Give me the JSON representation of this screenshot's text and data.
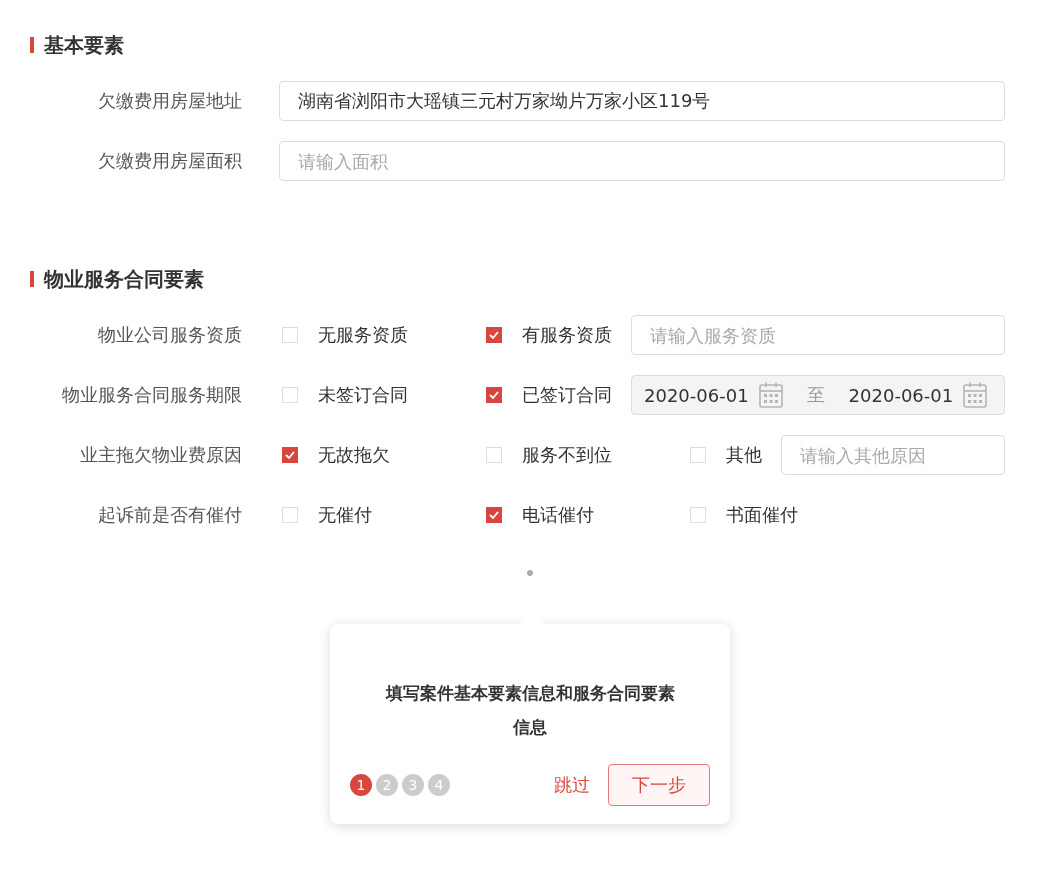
{
  "sections": [
    {
      "title": "基本要素",
      "rows": [
        {
          "label": "欠缴费用房屋地址",
          "items": [
            {
              "kind": "input",
              "value": "湖南省浏阳市大瑶镇三元村万家坳片万家小区119号"
            }
          ]
        },
        {
          "label": "欠缴费用房屋面积",
          "items": [
            {
              "kind": "input",
              "placeholder": "请输入面积"
            }
          ]
        }
      ]
    },
    {
      "title": "物业服务合同要素",
      "rows": [
        {
          "label": "物业公司服务资质",
          "items": [
            {
              "kind": "option",
              "label": "无服务资质",
              "checked": false
            },
            {
              "kind": "option",
              "label": "有服务资质",
              "checked": true
            },
            {
              "kind": "input",
              "placeholder": "请输入服务资质"
            }
          ]
        },
        {
          "label": "物业服务合同服务期限",
          "items": [
            {
              "kind": "option",
              "label": "未签订合同",
              "checked": false
            },
            {
              "kind": "option",
              "label": "已签订合同",
              "checked": true
            },
            {
              "kind": "daterange",
              "start": "2020-06-01",
              "separator": "至",
              "end": "2020-06-01"
            }
          ]
        },
        {
          "label": "业主拖欠物业费原因",
          "items": [
            {
              "kind": "option",
              "label": "无故拖欠",
              "checked": true
            },
            {
              "kind": "option",
              "label": "服务不到位",
              "checked": false
            },
            {
              "kind": "option",
              "label": "其他",
              "checked": false
            },
            {
              "kind": "input",
              "placeholder": "请输入其他原因"
            }
          ]
        },
        {
          "label": "起诉前是否有催付",
          "items": [
            {
              "kind": "option",
              "label": "无催付",
              "checked": false
            },
            {
              "kind": "option",
              "label": "电话催付",
              "checked": true
            },
            {
              "kind": "option",
              "label": "书面催付",
              "checked": false
            }
          ]
        }
      ]
    }
  ],
  "tour": {
    "message": "填写案件基本要素信息和服务合同要素信息",
    "steps": [
      {
        "label": "1",
        "selected": true
      },
      {
        "label": "2",
        "selected": false
      },
      {
        "label": "3",
        "selected": false
      },
      {
        "label": "4",
        "selected": false
      }
    ],
    "skip": "跳过",
    "next": "下一步"
  }
}
